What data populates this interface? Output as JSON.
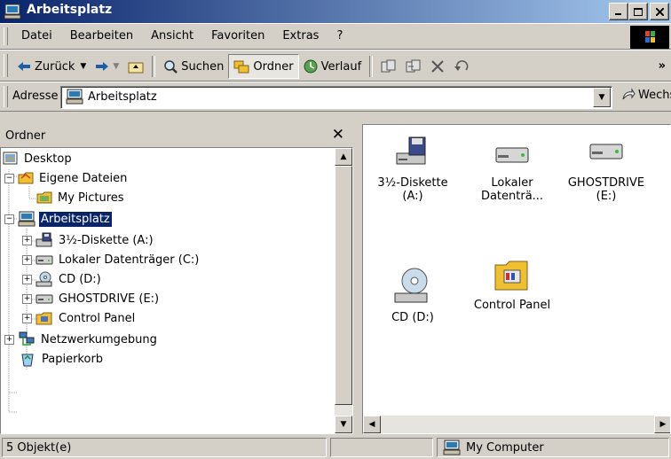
{
  "window": {
    "title": "Arbeitsplatz"
  },
  "menu": [
    "Datei",
    "Bearbeiten",
    "Ansicht",
    "Favoriten",
    "Extras",
    "?"
  ],
  "toolbar": {
    "back_label": "Zurück",
    "search_label": "Suchen",
    "folders_label": "Ordner",
    "history_label": "Verlauf"
  },
  "address": {
    "label": "Adresse",
    "value": "Arbeitsplatz",
    "go_label": "Wechseln zu"
  },
  "folders_pane": {
    "title": "Ordner",
    "tree": [
      {
        "label": "Desktop"
      },
      {
        "label": "Eigene Dateien"
      },
      {
        "label": "My Pictures"
      },
      {
        "label": "Arbeitsplatz"
      },
      {
        "label": "3½-Diskette (A:)"
      },
      {
        "label": "Lokaler Datenträger (C:)"
      },
      {
        "label": "CD (D:)"
      },
      {
        "label": "GHOSTDRIVE (E:)"
      },
      {
        "label": "Control Panel"
      },
      {
        "label": "Netzwerkumgebung"
      },
      {
        "label": "Papierkorb"
      }
    ]
  },
  "content": {
    "items": [
      {
        "line1": "3½-Diskette",
        "line2": "(A:)"
      },
      {
        "line1": "Lokaler",
        "line2": "Datenträ..."
      },
      {
        "line1": "GHOSTDRIVE",
        "line2": "(E:)"
      },
      {
        "line1": "CD (D:)",
        "line2": ""
      },
      {
        "line1": "Control Panel",
        "line2": ""
      }
    ]
  },
  "status": {
    "count": "5 Objekt(e)",
    "zone": "My Computer"
  }
}
